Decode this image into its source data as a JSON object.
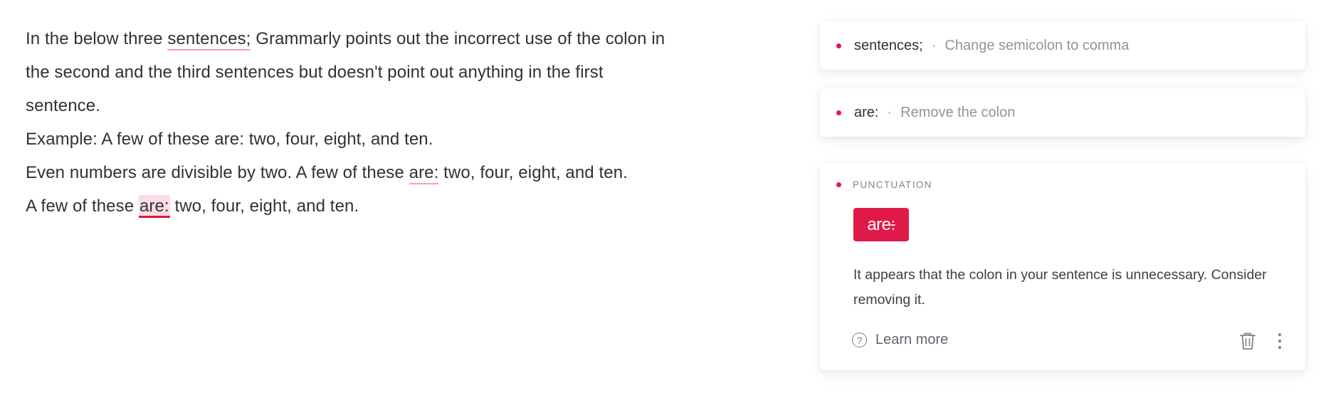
{
  "editor": {
    "p1_before": "In the below three ",
    "p1_flag": "sentences;",
    "p1_after": " Grammarly points out the incorrect use of the colon in the second and the third sentences but doesn't point out anything in the first sentence.",
    "p2": "Example: A few of these are: two, four, eight, and ten.",
    "p3_before": "Even numbers are divisible by two. A few of these ",
    "p3_flag": "are:",
    "p3_after": " two, four, eight, and ten.",
    "p4_before": "A few of these ",
    "p4_flag": "are:",
    "p4_after": " two, four, eight, and ten."
  },
  "cards": [
    {
      "word": "sentences;",
      "separator": "·",
      "suggestion": "Change semicolon to comma"
    },
    {
      "word": "are:",
      "separator": "·",
      "suggestion": "Remove the colon"
    }
  ],
  "expanded": {
    "category": "PUNCTUATION",
    "chip_word": "are",
    "chip_colon": ":",
    "explanation": "It appears that the colon in your sentence is unnecessary. Consider removing it.",
    "learn_more": "Learn more",
    "help_glyph": "?"
  },
  "colors": {
    "accent": "#e01a48",
    "underline": "#f2a3b4",
    "highlight": "#fbdde3"
  }
}
